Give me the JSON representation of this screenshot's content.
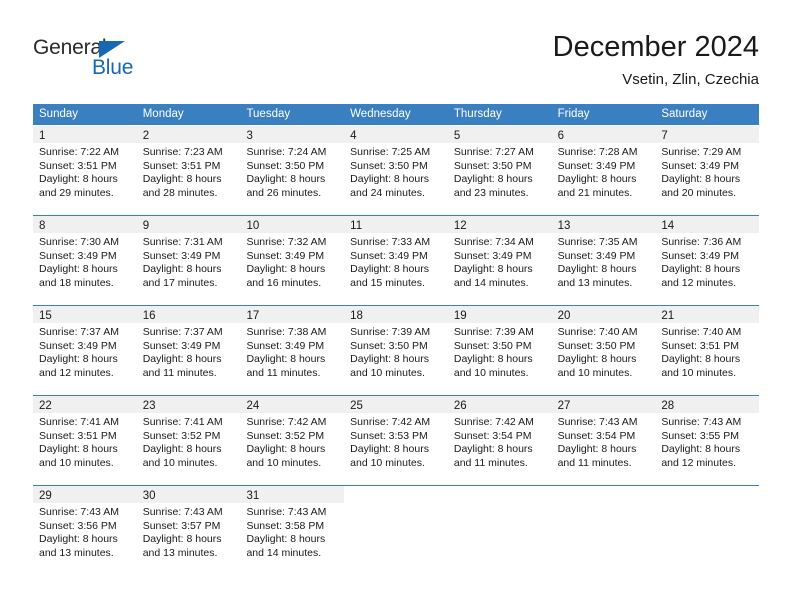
{
  "logo": {
    "word_one": "General",
    "word_two": "Blue",
    "triangle_color": "#1668b3"
  },
  "header": {
    "title": "December 2024",
    "subtitle": "Vsetin, Zlin, Czechia"
  },
  "colors": {
    "header_blue": "#3a7fc0",
    "day_band_gray": "#f0f0f0",
    "logo_blue": "#1668b3"
  },
  "weekdays": [
    "Sunday",
    "Monday",
    "Tuesday",
    "Wednesday",
    "Thursday",
    "Friday",
    "Saturday"
  ],
  "weeks": [
    {
      "days": [
        {
          "num": "1",
          "sunrise": "Sunrise: 7:22 AM",
          "sunset": "Sunset: 3:51 PM",
          "daylight1": "Daylight: 8 hours",
          "daylight2": "and 29 minutes."
        },
        {
          "num": "2",
          "sunrise": "Sunrise: 7:23 AM",
          "sunset": "Sunset: 3:51 PM",
          "daylight1": "Daylight: 8 hours",
          "daylight2": "and 28 minutes."
        },
        {
          "num": "3",
          "sunrise": "Sunrise: 7:24 AM",
          "sunset": "Sunset: 3:50 PM",
          "daylight1": "Daylight: 8 hours",
          "daylight2": "and 26 minutes."
        },
        {
          "num": "4",
          "sunrise": "Sunrise: 7:25 AM",
          "sunset": "Sunset: 3:50 PM",
          "daylight1": "Daylight: 8 hours",
          "daylight2": "and 24 minutes."
        },
        {
          "num": "5",
          "sunrise": "Sunrise: 7:27 AM",
          "sunset": "Sunset: 3:50 PM",
          "daylight1": "Daylight: 8 hours",
          "daylight2": "and 23 minutes."
        },
        {
          "num": "6",
          "sunrise": "Sunrise: 7:28 AM",
          "sunset": "Sunset: 3:49 PM",
          "daylight1": "Daylight: 8 hours",
          "daylight2": "and 21 minutes."
        },
        {
          "num": "7",
          "sunrise": "Sunrise: 7:29 AM",
          "sunset": "Sunset: 3:49 PM",
          "daylight1": "Daylight: 8 hours",
          "daylight2": "and 20 minutes."
        }
      ]
    },
    {
      "days": [
        {
          "num": "8",
          "sunrise": "Sunrise: 7:30 AM",
          "sunset": "Sunset: 3:49 PM",
          "daylight1": "Daylight: 8 hours",
          "daylight2": "and 18 minutes."
        },
        {
          "num": "9",
          "sunrise": "Sunrise: 7:31 AM",
          "sunset": "Sunset: 3:49 PM",
          "daylight1": "Daylight: 8 hours",
          "daylight2": "and 17 minutes."
        },
        {
          "num": "10",
          "sunrise": "Sunrise: 7:32 AM",
          "sunset": "Sunset: 3:49 PM",
          "daylight1": "Daylight: 8 hours",
          "daylight2": "and 16 minutes."
        },
        {
          "num": "11",
          "sunrise": "Sunrise: 7:33 AM",
          "sunset": "Sunset: 3:49 PM",
          "daylight1": "Daylight: 8 hours",
          "daylight2": "and 15 minutes."
        },
        {
          "num": "12",
          "sunrise": "Sunrise: 7:34 AM",
          "sunset": "Sunset: 3:49 PM",
          "daylight1": "Daylight: 8 hours",
          "daylight2": "and 14 minutes."
        },
        {
          "num": "13",
          "sunrise": "Sunrise: 7:35 AM",
          "sunset": "Sunset: 3:49 PM",
          "daylight1": "Daylight: 8 hours",
          "daylight2": "and 13 minutes."
        },
        {
          "num": "14",
          "sunrise": "Sunrise: 7:36 AM",
          "sunset": "Sunset: 3:49 PM",
          "daylight1": "Daylight: 8 hours",
          "daylight2": "and 12 minutes."
        }
      ]
    },
    {
      "days": [
        {
          "num": "15",
          "sunrise": "Sunrise: 7:37 AM",
          "sunset": "Sunset: 3:49 PM",
          "daylight1": "Daylight: 8 hours",
          "daylight2": "and 12 minutes."
        },
        {
          "num": "16",
          "sunrise": "Sunrise: 7:37 AM",
          "sunset": "Sunset: 3:49 PM",
          "daylight1": "Daylight: 8 hours",
          "daylight2": "and 11 minutes."
        },
        {
          "num": "17",
          "sunrise": "Sunrise: 7:38 AM",
          "sunset": "Sunset: 3:49 PM",
          "daylight1": "Daylight: 8 hours",
          "daylight2": "and 11 minutes."
        },
        {
          "num": "18",
          "sunrise": "Sunrise: 7:39 AM",
          "sunset": "Sunset: 3:50 PM",
          "daylight1": "Daylight: 8 hours",
          "daylight2": "and 10 minutes."
        },
        {
          "num": "19",
          "sunrise": "Sunrise: 7:39 AM",
          "sunset": "Sunset: 3:50 PM",
          "daylight1": "Daylight: 8 hours",
          "daylight2": "and 10 minutes."
        },
        {
          "num": "20",
          "sunrise": "Sunrise: 7:40 AM",
          "sunset": "Sunset: 3:50 PM",
          "daylight1": "Daylight: 8 hours",
          "daylight2": "and 10 minutes."
        },
        {
          "num": "21",
          "sunrise": "Sunrise: 7:40 AM",
          "sunset": "Sunset: 3:51 PM",
          "daylight1": "Daylight: 8 hours",
          "daylight2": "and 10 minutes."
        }
      ]
    },
    {
      "days": [
        {
          "num": "22",
          "sunrise": "Sunrise: 7:41 AM",
          "sunset": "Sunset: 3:51 PM",
          "daylight1": "Daylight: 8 hours",
          "daylight2": "and 10 minutes."
        },
        {
          "num": "23",
          "sunrise": "Sunrise: 7:41 AM",
          "sunset": "Sunset: 3:52 PM",
          "daylight1": "Daylight: 8 hours",
          "daylight2": "and 10 minutes."
        },
        {
          "num": "24",
          "sunrise": "Sunrise: 7:42 AM",
          "sunset": "Sunset: 3:52 PM",
          "daylight1": "Daylight: 8 hours",
          "daylight2": "and 10 minutes."
        },
        {
          "num": "25",
          "sunrise": "Sunrise: 7:42 AM",
          "sunset": "Sunset: 3:53 PM",
          "daylight1": "Daylight: 8 hours",
          "daylight2": "and 10 minutes."
        },
        {
          "num": "26",
          "sunrise": "Sunrise: 7:42 AM",
          "sunset": "Sunset: 3:54 PM",
          "daylight1": "Daylight: 8 hours",
          "daylight2": "and 11 minutes."
        },
        {
          "num": "27",
          "sunrise": "Sunrise: 7:43 AM",
          "sunset": "Sunset: 3:54 PM",
          "daylight1": "Daylight: 8 hours",
          "daylight2": "and 11 minutes."
        },
        {
          "num": "28",
          "sunrise": "Sunrise: 7:43 AM",
          "sunset": "Sunset: 3:55 PM",
          "daylight1": "Daylight: 8 hours",
          "daylight2": "and 12 minutes."
        }
      ]
    },
    {
      "days": [
        {
          "num": "29",
          "sunrise": "Sunrise: 7:43 AM",
          "sunset": "Sunset: 3:56 PM",
          "daylight1": "Daylight: 8 hours",
          "daylight2": "and 13 minutes."
        },
        {
          "num": "30",
          "sunrise": "Sunrise: 7:43 AM",
          "sunset": "Sunset: 3:57 PM",
          "daylight1": "Daylight: 8 hours",
          "daylight2": "and 13 minutes."
        },
        {
          "num": "31",
          "sunrise": "Sunrise: 7:43 AM",
          "sunset": "Sunset: 3:58 PM",
          "daylight1": "Daylight: 8 hours",
          "daylight2": "and 14 minutes."
        },
        {
          "num": "",
          "sunrise": "",
          "sunset": "",
          "daylight1": "",
          "daylight2": ""
        },
        {
          "num": "",
          "sunrise": "",
          "sunset": "",
          "daylight1": "",
          "daylight2": ""
        },
        {
          "num": "",
          "sunrise": "",
          "sunset": "",
          "daylight1": "",
          "daylight2": ""
        },
        {
          "num": "",
          "sunrise": "",
          "sunset": "",
          "daylight1": "",
          "daylight2": ""
        }
      ]
    }
  ]
}
